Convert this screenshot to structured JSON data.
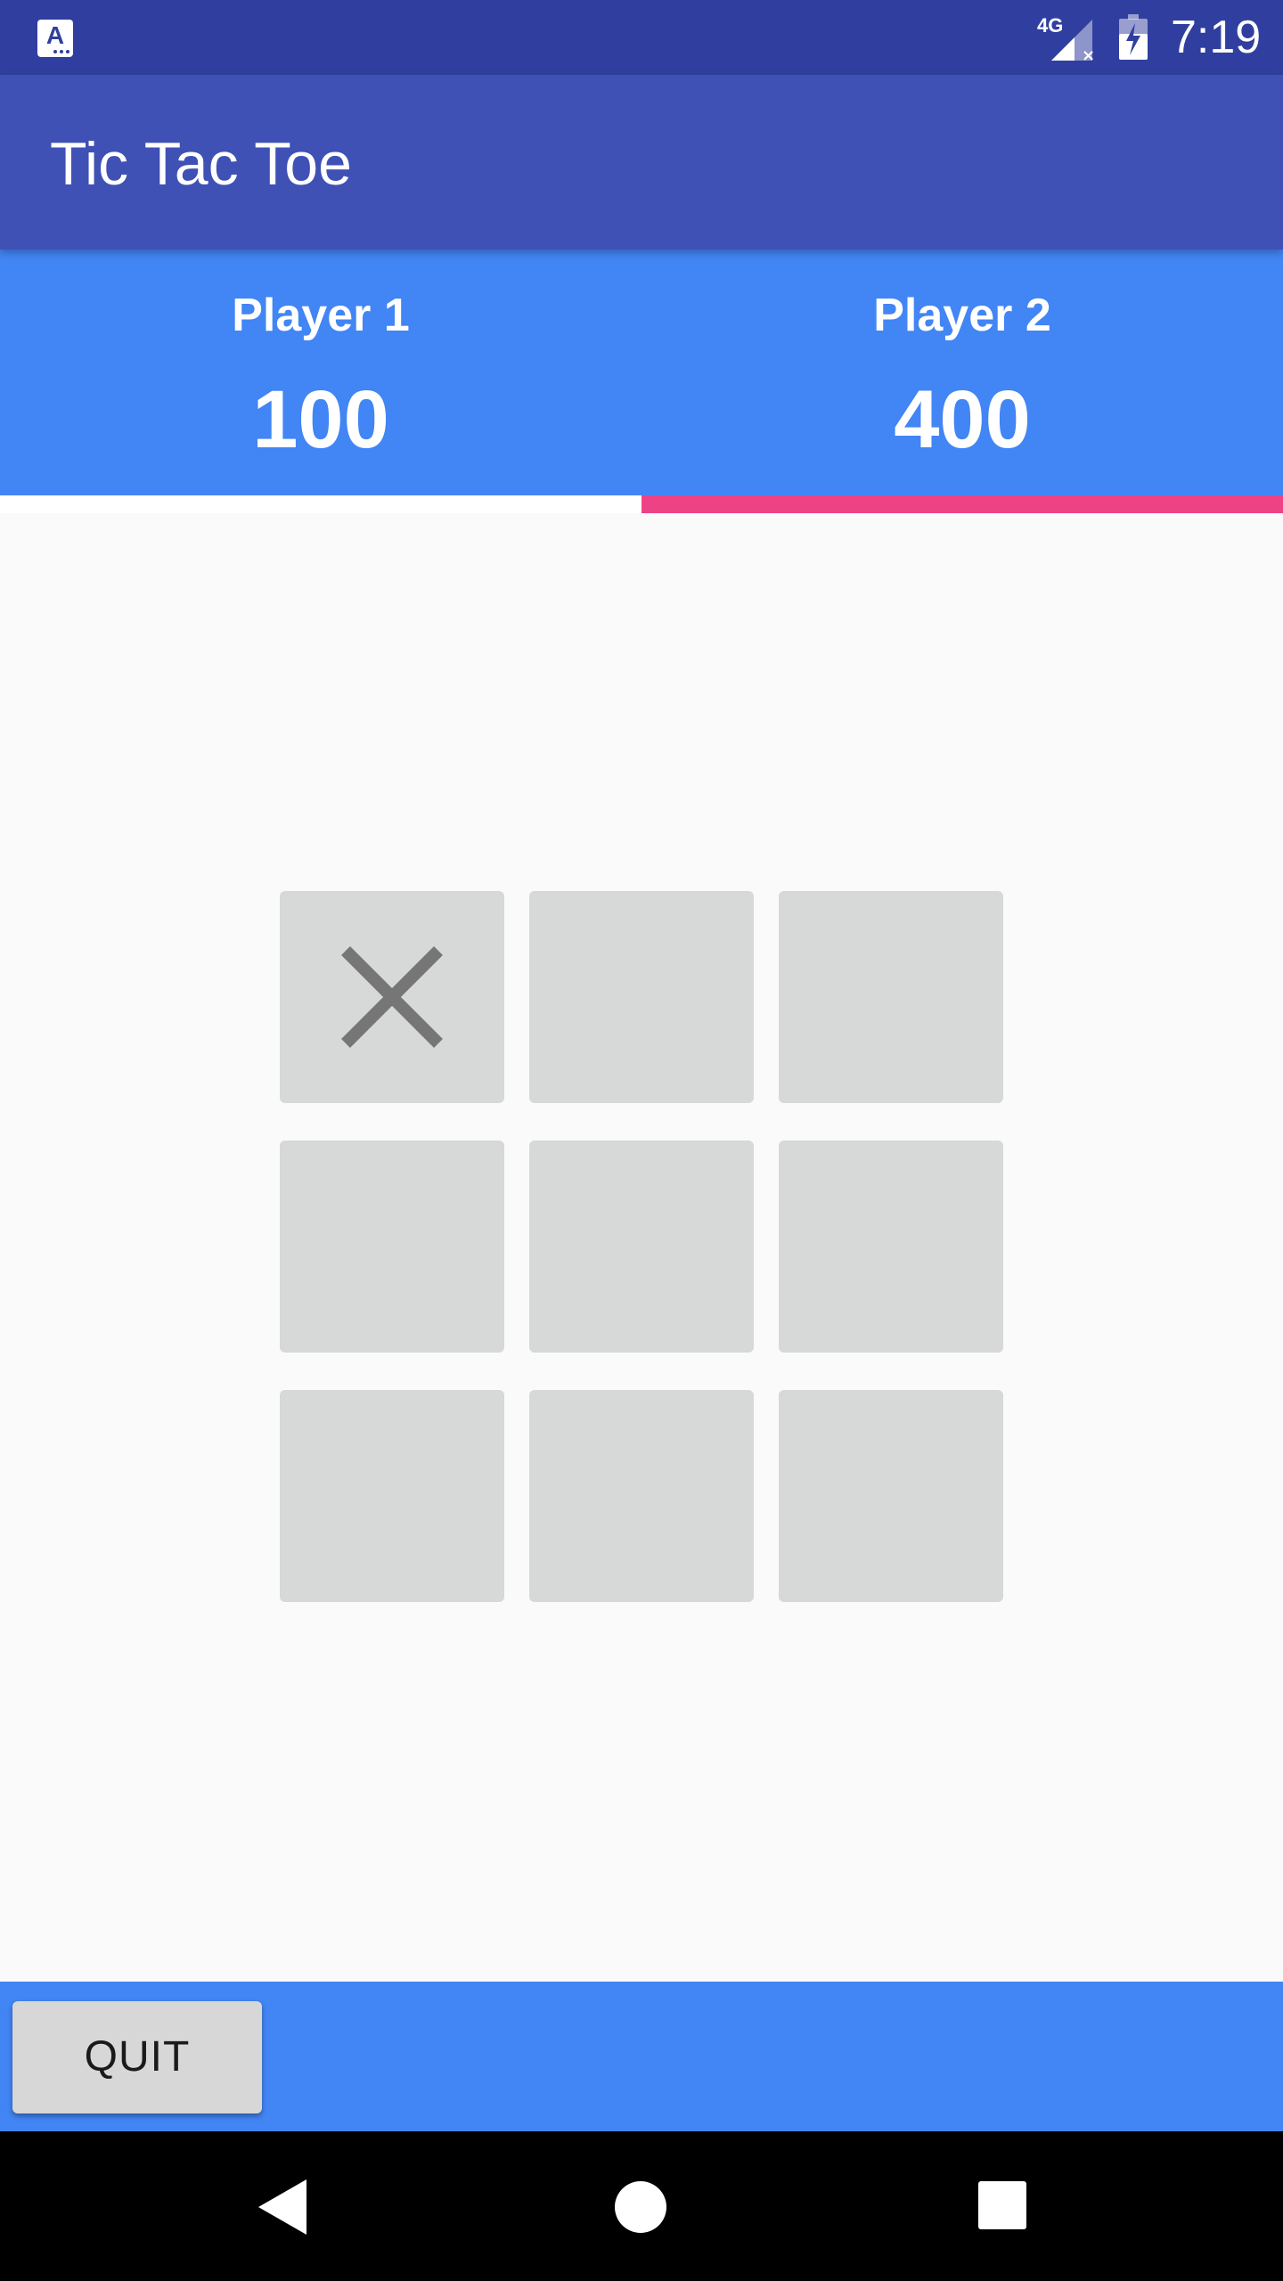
{
  "status_bar": {
    "network": "4G",
    "time": "7:19"
  },
  "app_bar": {
    "title": "Tic Tac Toe"
  },
  "scores": {
    "player1": {
      "name": "Player 1",
      "score": "100"
    },
    "player2": {
      "name": "Player 2",
      "score": "400"
    },
    "active_player": 2
  },
  "board": {
    "cells": [
      "X",
      "",
      "",
      "",
      "",
      "",
      "",
      "",
      ""
    ]
  },
  "bottom_bar": {
    "quit_label": "QUIT"
  },
  "colors": {
    "status_bar": "#303f9f",
    "app_bar": "#3f51b5",
    "panel": "#4285f4",
    "active_indicator": "#ee4286",
    "cell": "#d7d8d8",
    "mark": "#767676"
  },
  "icons": {
    "status_app": "keyboard-app-icon",
    "signal": "signal-no-data-icon",
    "battery": "battery-charging-icon",
    "nav_back": "back-triangle-icon",
    "nav_home": "home-circle-icon",
    "nav_recent": "recent-apps-square-icon"
  }
}
